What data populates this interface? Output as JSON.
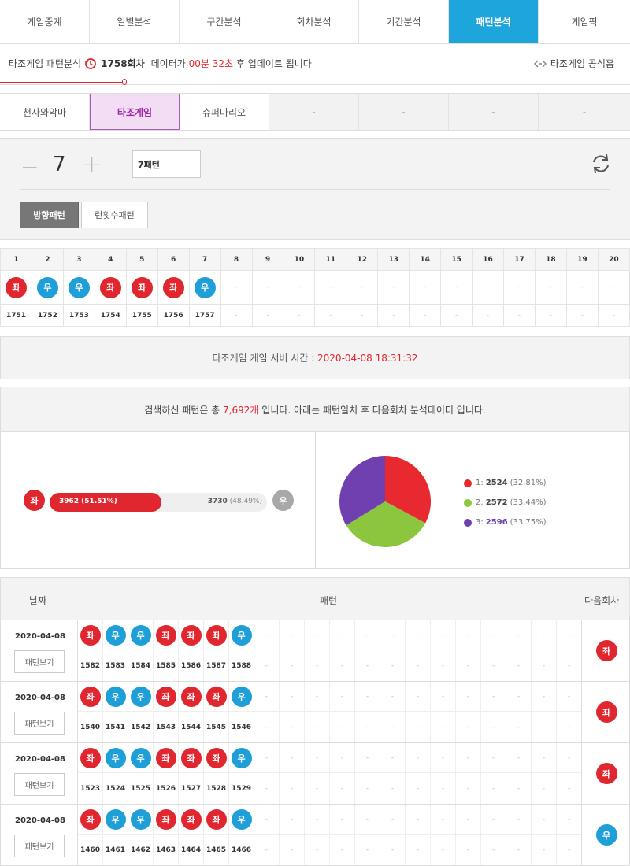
{
  "tabs": [
    "게임중계",
    "일별분석",
    "구간분석",
    "회차분석",
    "기간분석",
    "패턴분석",
    "게임픽"
  ],
  "info": {
    "prefix": "타조게임 패턴분석",
    "round": "1758회차",
    "mid": "데이터가",
    "countdown": "00분 32초",
    "suffix": "후 업데이트 됩니다",
    "official": "타조게임 공식홈"
  },
  "game_tabs": [
    "천사와악마",
    "타조게임",
    "슈퍼마리오",
    "-",
    "-",
    "-",
    "-"
  ],
  "controls": {
    "minus": "−",
    "count": "7",
    "plus": "+",
    "pattern_input": "7패턴",
    "mode_direction": "방향패턴",
    "mode_run": "런횟수패턴"
  },
  "grid": {
    "columns": [
      "1",
      "2",
      "3",
      "4",
      "5",
      "6",
      "7",
      "8",
      "9",
      "10",
      "11",
      "12",
      "13",
      "14",
      "15",
      "16",
      "17",
      "18",
      "19",
      "20"
    ],
    "balls": [
      "좌",
      "우",
      "우",
      "좌",
      "좌",
      "좌",
      "우"
    ],
    "ball_types": [
      "L",
      "R",
      "R",
      "L",
      "L",
      "L",
      "R"
    ],
    "rounds": [
      "1751",
      "1752",
      "1753",
      "1754",
      "1755",
      "1756",
      "1757"
    ],
    "empty": "-"
  },
  "server_time": {
    "label": "타조게임 게임 서버 시간 :",
    "value": "2020-04-08 18:31:32"
  },
  "result": {
    "pre": "검색하신 패턴은 총",
    "count": "7,692개",
    "post": "입니다. 아래는 패턴일치 후 다음회차 분석데이터 입니다.",
    "left_label": "좌",
    "right_label": "우",
    "left_text": "3962 (51.51%)",
    "right_value": "3730",
    "right_pct": "(48.49%)",
    "left_fraction": 0.5151,
    "pie": [
      {
        "label": "1",
        "value": "2524",
        "pct": "(32.81%)",
        "color": "#e8292f",
        "share": 0.3281
      },
      {
        "label": "2",
        "value": "2572",
        "pct": "(33.44%)",
        "color": "#8cc63f",
        "share": 0.3344
      },
      {
        "label": "3",
        "value": "2596",
        "pct": "(33.75%)",
        "color": "#7040b0",
        "share": 0.3375
      }
    ]
  },
  "history": {
    "col_date": "날짜",
    "col_pattern": "패턴",
    "col_next": "다음회차",
    "view_button": "패턴보기",
    "rows": [
      {
        "date": "2020-04-08",
        "balls": [
          "좌",
          "우",
          "우",
          "좌",
          "좌",
          "좌",
          "우"
        ],
        "types": [
          "L",
          "R",
          "R",
          "L",
          "L",
          "L",
          "R"
        ],
        "rounds": [
          "1582",
          "1583",
          "1584",
          "1585",
          "1586",
          "1587",
          "1588"
        ],
        "next": "좌",
        "next_type": "L"
      },
      {
        "date": "2020-04-08",
        "balls": [
          "좌",
          "우",
          "우",
          "좌",
          "좌",
          "좌",
          "우"
        ],
        "types": [
          "L",
          "R",
          "R",
          "L",
          "L",
          "L",
          "R"
        ],
        "rounds": [
          "1540",
          "1541",
          "1542",
          "1543",
          "1544",
          "1545",
          "1546"
        ],
        "next": "좌",
        "next_type": "L"
      },
      {
        "date": "2020-04-08",
        "balls": [
          "좌",
          "우",
          "우",
          "좌",
          "좌",
          "좌",
          "우"
        ],
        "types": [
          "L",
          "R",
          "R",
          "L",
          "L",
          "L",
          "R"
        ],
        "rounds": [
          "1523",
          "1524",
          "1525",
          "1526",
          "1527",
          "1528",
          "1529"
        ],
        "next": "좌",
        "next_type": "L"
      },
      {
        "date": "2020-04-08",
        "balls": [
          "좌",
          "우",
          "우",
          "좌",
          "좌",
          "좌",
          "우"
        ],
        "types": [
          "L",
          "R",
          "R",
          "L",
          "L",
          "L",
          "R"
        ],
        "rounds": [
          "1460",
          "1461",
          "1462",
          "1463",
          "1464",
          "1465",
          "1466"
        ],
        "next": "우",
        "next_type": "R"
      }
    ]
  },
  "colors": {
    "accent": "#1ea6dc",
    "red": "#e0262e",
    "blue": "#1e9fd8",
    "purple": "#9c2aa8"
  }
}
